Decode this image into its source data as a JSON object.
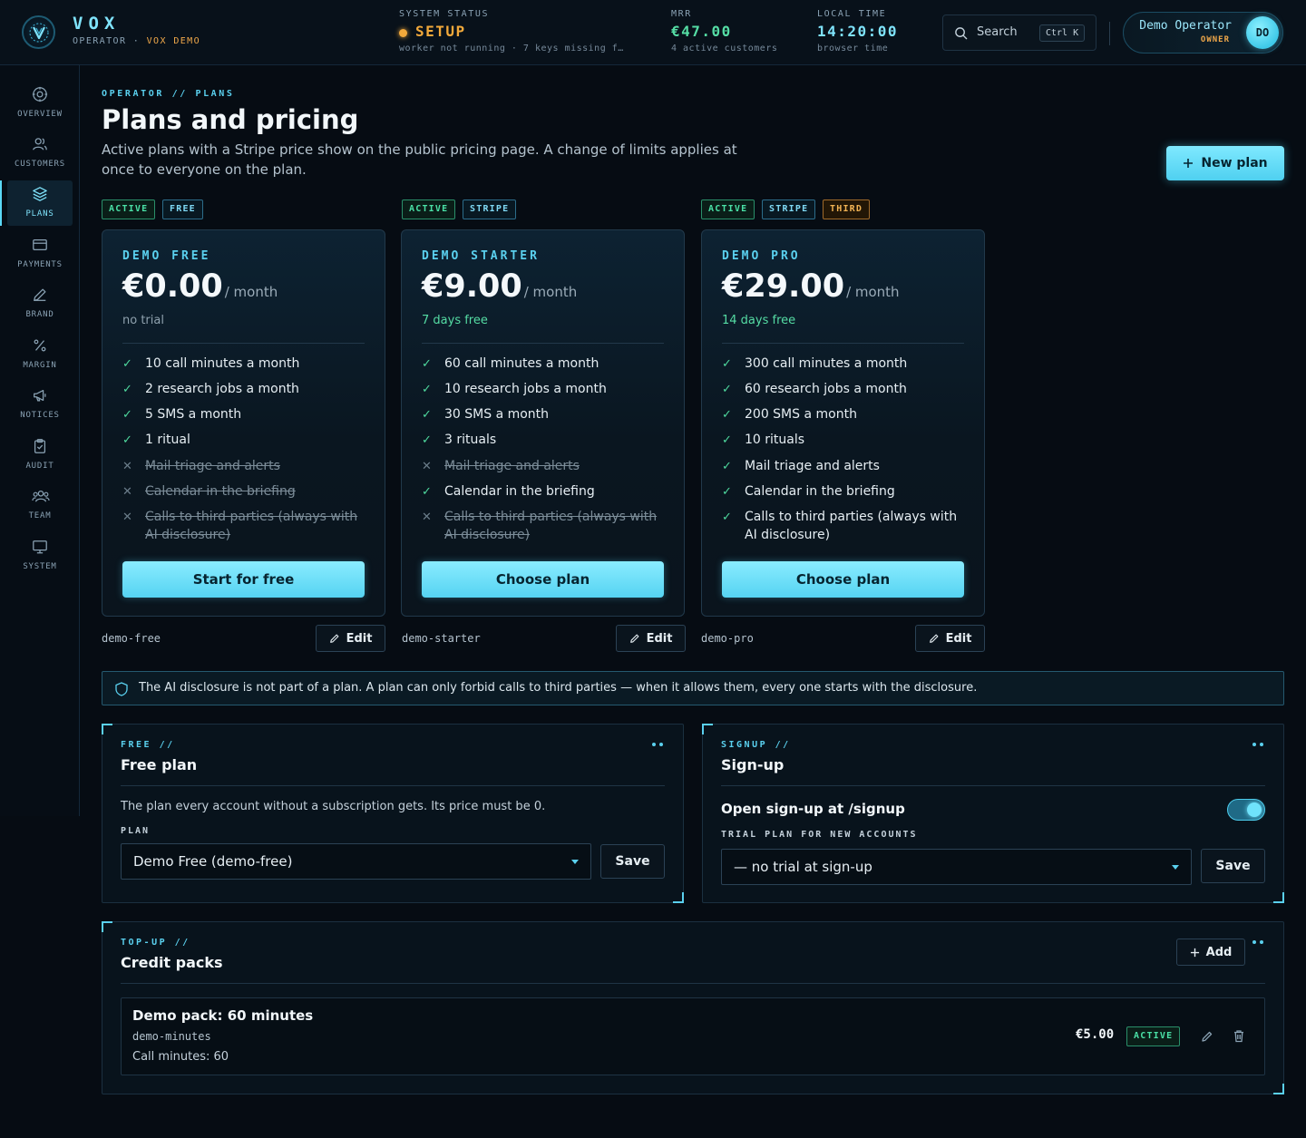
{
  "brand": {
    "name": "VOX",
    "role": "OPERATOR",
    "separator": "·",
    "env": "VOX DEMO"
  },
  "topbar": {
    "status": {
      "label": "SYSTEM STATUS",
      "value": "SETUP",
      "sub": "worker not running · 7 keys missing f…",
      "color": "#f2a93b"
    },
    "mrr": {
      "label": "MRR",
      "value": "€47.00",
      "sub": "4 active customers"
    },
    "time": {
      "label": "LOCAL TIME",
      "value": "14:20:00",
      "sub": "browser time"
    },
    "search": {
      "label": "Search",
      "shortcut": "Ctrl K"
    },
    "user": {
      "name": "Demo Operator",
      "role": "OWNER",
      "initials": "DO"
    }
  },
  "sidebar": {
    "items": [
      {
        "label": "OVERVIEW",
        "icon": "target-icon"
      },
      {
        "label": "CUSTOMERS",
        "icon": "users-icon"
      },
      {
        "label": "PLANS",
        "icon": "layers-icon",
        "active": true
      },
      {
        "label": "PAYMENTS",
        "icon": "credit-card-icon"
      },
      {
        "label": "BRAND",
        "icon": "pen-icon"
      },
      {
        "label": "MARGIN",
        "icon": "percent-icon"
      },
      {
        "label": "NOTICES",
        "icon": "megaphone-icon"
      },
      {
        "label": "AUDIT",
        "icon": "clipboard-icon"
      },
      {
        "label": "TEAM",
        "icon": "team-icon"
      },
      {
        "label": "SYSTEM",
        "icon": "monitor-icon"
      }
    ]
  },
  "page": {
    "breadcrumb": "OPERATOR // PLANS",
    "title": "Plans and pricing",
    "description": "Active plans with a Stripe price show on the public pricing page. A change of limits applies at once to everyone on the plan.",
    "new_plan_label": "New plan"
  },
  "plans": [
    {
      "badges": [
        "ACTIVE",
        "FREE"
      ],
      "name": "DEMO FREE",
      "price": "€0.00",
      "period": "/ month",
      "trial": "no trial",
      "features": [
        {
          "text": "10 call minutes a month",
          "on": true
        },
        {
          "text": "2 research jobs a month",
          "on": true
        },
        {
          "text": "5 SMS a month",
          "on": true
        },
        {
          "text": "1 ritual",
          "on": true
        },
        {
          "text": "Mail triage and alerts",
          "on": false
        },
        {
          "text": "Calendar in the briefing",
          "on": false
        },
        {
          "text": "Calls to third parties (always with AI disclosure)",
          "on": false
        }
      ],
      "cta": "Start for free",
      "slug": "demo-free",
      "edit_label": "Edit"
    },
    {
      "badges": [
        "ACTIVE",
        "STRIPE"
      ],
      "name": "DEMO STARTER",
      "price": "€9.00",
      "period": "/ month",
      "trial": "7 days free",
      "features": [
        {
          "text": "60 call minutes a month",
          "on": true
        },
        {
          "text": "10 research jobs a month",
          "on": true
        },
        {
          "text": "30 SMS a month",
          "on": true
        },
        {
          "text": "3 rituals",
          "on": true
        },
        {
          "text": "Mail triage and alerts",
          "on": false
        },
        {
          "text": "Calendar in the briefing",
          "on": true
        },
        {
          "text": "Calls to third parties (always with AI disclosure)",
          "on": false
        }
      ],
      "cta": "Choose plan",
      "slug": "demo-starter",
      "edit_label": "Edit"
    },
    {
      "badges": [
        "ACTIVE",
        "STRIPE",
        "THIRD"
      ],
      "name": "DEMO PRO",
      "price": "€29.00",
      "period": "/ month",
      "trial": "14 days free",
      "features": [
        {
          "text": "300 call minutes a month",
          "on": true
        },
        {
          "text": "60 research jobs a month",
          "on": true
        },
        {
          "text": "200 SMS a month",
          "on": true
        },
        {
          "text": "10 rituals",
          "on": true
        },
        {
          "text": "Mail triage and alerts",
          "on": true
        },
        {
          "text": "Calendar in the briefing",
          "on": true
        },
        {
          "text": "Calls to third parties (always with AI disclosure)",
          "on": true
        }
      ],
      "cta": "Choose plan",
      "slug": "demo-pro",
      "edit_label": "Edit"
    }
  ],
  "notice": "The AI disclosure is not part of a plan. A plan can only forbid calls to third parties — when it allows them, every one starts with the disclosure.",
  "free_panel": {
    "eyebrow": "FREE //",
    "title": "Free plan",
    "description": "The plan every account without a subscription gets. Its price must be 0.",
    "field_label": "PLAN",
    "selected": "Demo Free (demo-free)",
    "save_label": "Save"
  },
  "signup_panel": {
    "eyebrow": "SIGNUP //",
    "title": "Sign-up",
    "toggle_label": "Open sign-up at /signup",
    "toggle_on": true,
    "field_label": "TRIAL PLAN FOR NEW ACCOUNTS",
    "selected": "— no trial at sign-up",
    "save_label": "Save"
  },
  "credit_panel": {
    "eyebrow": "TOP-UP //",
    "title": "Credit packs",
    "add_label": "Add",
    "packs": [
      {
        "name": "Demo pack: 60 minutes",
        "slug": "demo-minutes",
        "detail": "Call minutes: 60",
        "price": "€5.00",
        "status": "ACTIVE"
      }
    ]
  }
}
